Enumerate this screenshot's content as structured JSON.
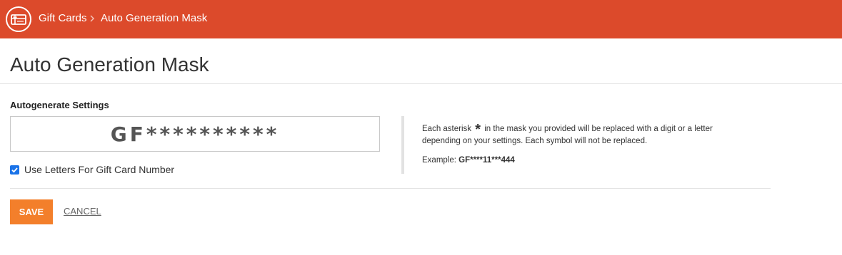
{
  "header": {
    "app_icon": "gift-card-icon",
    "breadcrumb_root": "Gift Cards",
    "breadcrumb_separator_icon": "chevron-right-icon",
    "breadcrumb_current": "Auto Generation Mask",
    "bar_color": "#dc4a2b"
  },
  "page": {
    "title": "Auto Generation Mask"
  },
  "settings": {
    "section_label": "Autogenerate Settings",
    "mask_value": "GF**********",
    "use_letters_checked": true,
    "use_letters_label": "Use Letters For Gift Card Number"
  },
  "info": {
    "line1_before": "Each asterisk",
    "asterisk": "*",
    "line1_after": "in the mask you provided will be replaced with a digit or a letter",
    "line2": "depending on your settings. Each symbol will not be replaced.",
    "example_label": "Example:",
    "example_value": "GF****11***444"
  },
  "actions": {
    "save_label": "SAVE",
    "cancel_label": "CANCEL",
    "save_color": "#f37f2b"
  }
}
